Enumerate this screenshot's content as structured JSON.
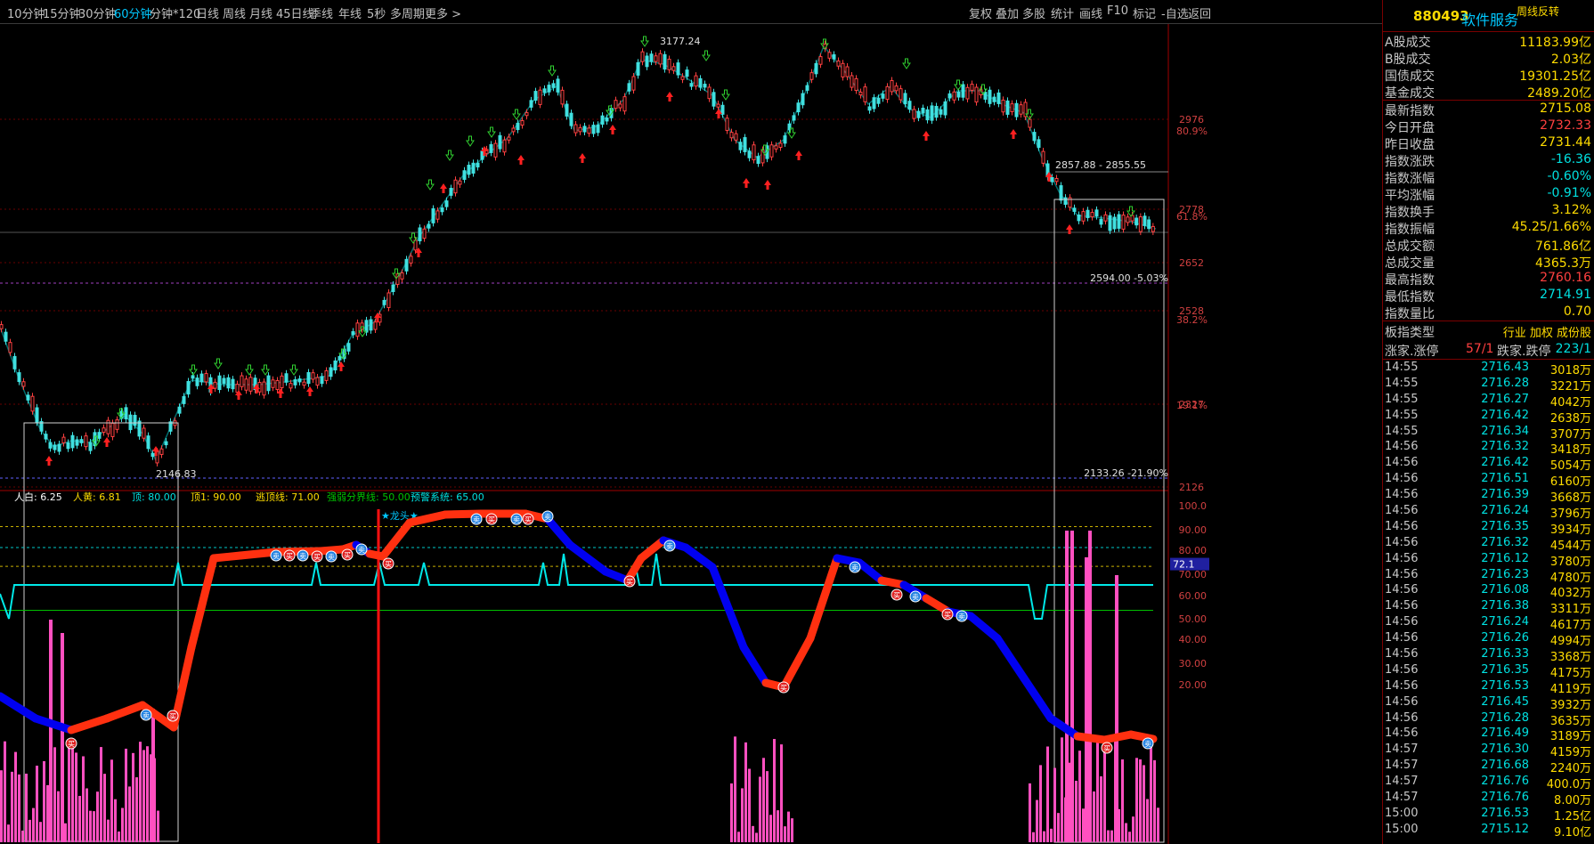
{
  "toolbar": {
    "periods": [
      "10分钟",
      "15分钟",
      "30分钟",
      "60分钟",
      "分钟*120",
      "日线",
      "周线",
      "月线",
      "45日线",
      "季线",
      "年线",
      "5秒",
      "多周期",
      "更多 >"
    ],
    "active_period": "60分钟",
    "tools": [
      "复权",
      "叠加",
      "多股",
      "统计",
      "画线",
      "F10",
      "标记",
      "-自选",
      "返回"
    ]
  },
  "security": {
    "code": "880493",
    "name": "软件服务",
    "badge": "周线反转"
  },
  "stats": [
    {
      "label": "A股成交",
      "value": "11183.99亿",
      "color": "yellow"
    },
    {
      "label": "B股成交",
      "value": "2.03亿",
      "color": "yellow"
    },
    {
      "label": "国债成交",
      "value": "19301.25亿",
      "color": "yellow"
    },
    {
      "label": "基金成交",
      "value": "2489.20亿",
      "color": "yellow"
    },
    {
      "label": "最新指数",
      "value": "2715.08",
      "color": "yellow"
    },
    {
      "label": "今日开盘",
      "value": "2732.33",
      "color": "red"
    },
    {
      "label": "昨日收盘",
      "value": "2731.44",
      "color": "yellow"
    },
    {
      "label": "指数涨跌",
      "value": "-16.36",
      "color": "cyan"
    },
    {
      "label": "指数涨幅",
      "value": "-0.60%",
      "color": "cyan"
    },
    {
      "label": "平均涨幅",
      "value": "-0.91%",
      "color": "cyan"
    },
    {
      "label": "指数换手",
      "value": "3.12%",
      "color": "yellow"
    },
    {
      "label": "指数振幅",
      "value": "45.25/1.66%",
      "color": "yellow"
    },
    {
      "label": "总成交额",
      "value": "761.86亿",
      "color": "yellow"
    },
    {
      "label": "总成交量",
      "value": "4365.3万",
      "color": "yellow"
    },
    {
      "label": "最高指数",
      "value": "2760.16",
      "color": "red"
    },
    {
      "label": "最低指数",
      "value": "2714.91",
      "color": "cyan"
    },
    {
      "label": "指数量比",
      "value": "0.70",
      "color": "yellow"
    }
  ],
  "board": {
    "label": "板指类型",
    "value": "行业 加权 成份股"
  },
  "limits": {
    "up_label": "涨家.涨停",
    "up_value": "57/1",
    "down_label": "跌家.跌停",
    "down_value": "223/1"
  },
  "ticks": [
    {
      "time": "14:55",
      "price": "2716.43",
      "vol": "3018万"
    },
    {
      "time": "14:55",
      "price": "2716.28",
      "vol": "3221万"
    },
    {
      "time": "14:55",
      "price": "2716.27",
      "vol": "4042万"
    },
    {
      "time": "14:55",
      "price": "2716.42",
      "vol": "2638万"
    },
    {
      "time": "14:55",
      "price": "2716.34",
      "vol": "3707万"
    },
    {
      "time": "14:56",
      "price": "2716.32",
      "vol": "3418万"
    },
    {
      "time": "14:56",
      "price": "2716.42",
      "vol": "5054万"
    },
    {
      "time": "14:56",
      "price": "2716.51",
      "vol": "6160万"
    },
    {
      "time": "14:56",
      "price": "2716.39",
      "vol": "3668万"
    },
    {
      "time": "14:56",
      "price": "2716.24",
      "vol": "3796万"
    },
    {
      "time": "14:56",
      "price": "2716.35",
      "vol": "3934万"
    },
    {
      "time": "14:56",
      "price": "2716.32",
      "vol": "4544万"
    },
    {
      "time": "14:56",
      "price": "2716.12",
      "vol": "3780万"
    },
    {
      "time": "14:56",
      "price": "2716.23",
      "vol": "4780万"
    },
    {
      "time": "14:56",
      "price": "2716.08",
      "vol": "4032万"
    },
    {
      "time": "14:56",
      "price": "2716.38",
      "vol": "3311万"
    },
    {
      "time": "14:56",
      "price": "2716.24",
      "vol": "4617万"
    },
    {
      "time": "14:56",
      "price": "2716.26",
      "vol": "4994万"
    },
    {
      "time": "14:56",
      "price": "2716.33",
      "vol": "3368万"
    },
    {
      "time": "14:56",
      "price": "2716.35",
      "vol": "4175万"
    },
    {
      "time": "14:56",
      "price": "2716.53",
      "vol": "4119万"
    },
    {
      "time": "14:56",
      "price": "2716.45",
      "vol": "3932万"
    },
    {
      "time": "14:56",
      "price": "2716.28",
      "vol": "3635万"
    },
    {
      "time": "14:56",
      "price": "2716.49",
      "vol": "3189万"
    },
    {
      "time": "14:57",
      "price": "2716.30",
      "vol": "4159万"
    },
    {
      "time": "14:57",
      "price": "2716.68",
      "vol": "2240万"
    },
    {
      "time": "14:57",
      "price": "2716.76",
      "vol": "400.0万"
    },
    {
      "time": "14:57",
      "price": "2716.76",
      "vol": "8.00万"
    },
    {
      "time": "15:00",
      "price": "2716.53",
      "vol": "1.25亿"
    },
    {
      "time": "15:00",
      "price": "2715.12",
      "vol": "9.10亿"
    }
  ],
  "chart_data": {
    "type": "candlestick",
    "price_axis": {
      "labels": [
        "2976",
        "2778",
        "2652",
        "2528",
        "2327",
        "2126"
      ],
      "fib_labels": [
        "80.9%",
        "61.8%",
        "38.2%",
        "19.1%"
      ]
    },
    "annotations": {
      "high": "3177.24",
      "low": "2146.83",
      "range1": "2857.88 - 2855.55",
      "line1": "2594.00 -5.03%",
      "line2": "2133.26 -21.90%",
      "dragon": "★龙头★"
    },
    "indicator": {
      "legend": [
        {
          "text": "人白: 6.25",
          "color": "#ffffff"
        },
        {
          "text": "人黄: 6.81",
          "color": "#ffdc00"
        },
        {
          "text": "顶: 80.00",
          "color": "#00e0e0"
        },
        {
          "text": "顶1: 90.00",
          "color": "#ffdc00"
        },
        {
          "text": "逃顶线: 71.00",
          "color": "#ffdc00"
        },
        {
          "text": "强弱分界线: 50.00",
          "color": "#00c000"
        },
        {
          "text": "预警系统: 65.00",
          "color": "#00e0e0"
        }
      ],
      "axis": [
        "100.0",
        "90.00",
        "80.00",
        "70.00",
        "60.00",
        "50.00",
        "40.00",
        "30.00",
        "20.00"
      ],
      "current_value": "72.1",
      "buy_label": "买",
      "sell_label": "卖"
    }
  }
}
